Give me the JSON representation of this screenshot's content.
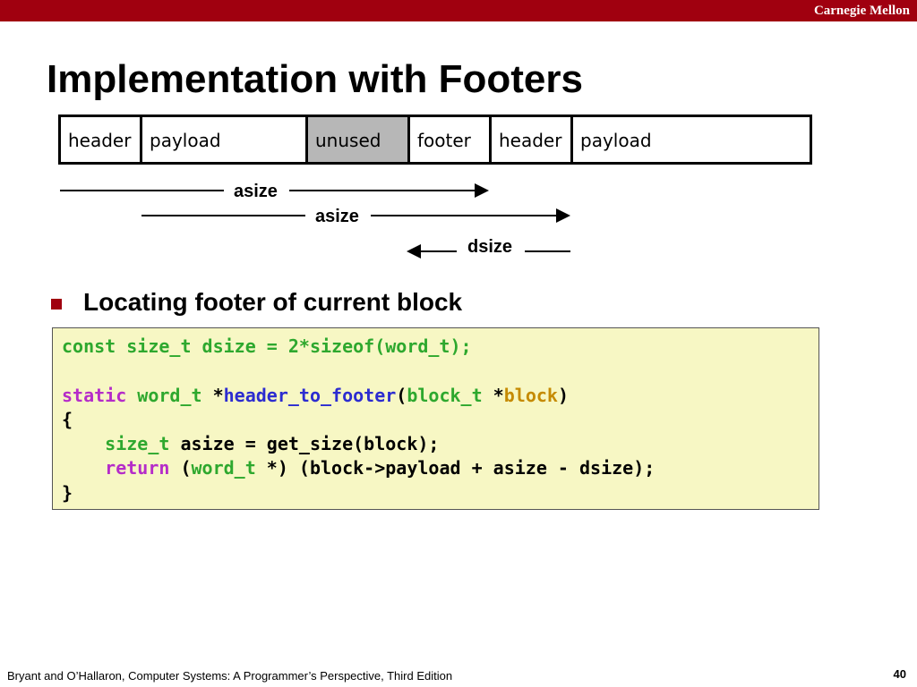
{
  "header": {
    "brand": "Carnegie Mellon"
  },
  "slide": {
    "title": "Implementation with Footers",
    "page_number": "40"
  },
  "diagram": {
    "blocks": [
      {
        "label": "header",
        "fill": "#ffffff"
      },
      {
        "label": "payload",
        "fill": "#ffffff"
      },
      {
        "label": "unused",
        "fill": "#b7b7b7"
      },
      {
        "label": "footer",
        "fill": "#ffffff"
      },
      {
        "label": "header",
        "fill": "#ffffff"
      },
      {
        "label": "payload",
        "fill": "#ffffff"
      }
    ],
    "arrows": [
      {
        "label": "asize",
        "direction": "right"
      },
      {
        "label": "asize",
        "direction": "right"
      },
      {
        "label": "dsize",
        "direction": "left"
      }
    ]
  },
  "bullet": {
    "text": "Locating footer of current block"
  },
  "code": {
    "line1": {
      "a": "const size_t dsize = 2*sizeof(word_t);"
    },
    "line3": {
      "static": "static",
      "word_t": "word_t",
      "star": " *",
      "fn": "header_to_footer",
      "paren_open": "(",
      "block_t": "block_t",
      "star2": " *",
      "block": "block",
      "paren_close": ")"
    },
    "line4": {
      "brace": "{"
    },
    "line5": {
      "indent": "    ",
      "size_t": "size_t",
      "rest": " asize = get_size(block);"
    },
    "line6": {
      "indent": "    ",
      "return": "return",
      "sp_paren": " (",
      "word_t": "word_t",
      "rest": " *) (block->payload + asize - dsize);"
    },
    "line7": {
      "brace": "}"
    }
  },
  "footer": {
    "citation": "Bryant and O’Hallaron, Computer Systems: A Programmer’s Perspective, Third Edition"
  },
  "colors": {
    "brand_red": "#a0000f",
    "code_bg": "#f7f7c4",
    "keyword_green": "#2ea82e",
    "keyword_purple": "#b52cc9",
    "function_blue": "#2c2cd0",
    "param_gold": "#c58a00"
  }
}
